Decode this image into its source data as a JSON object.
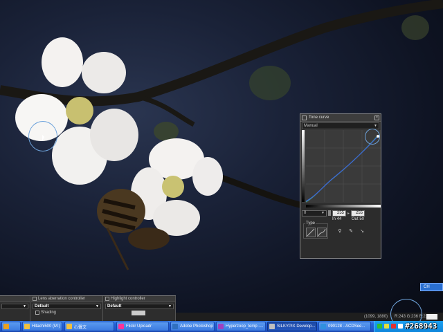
{
  "tone_curve": {
    "title": "Tone curve",
    "preset": "Manual",
    "channel": "0",
    "value_a": "255",
    "value_b": "255",
    "in_label": "In 44",
    "out_label": "Out 50",
    "type_label": "Type"
  },
  "panels": {
    "lens": {
      "title": "Lens aberration controller",
      "preset": "Default",
      "shading_label": "Shading"
    },
    "highlight": {
      "title": "Highlight controller",
      "preset": "Default"
    }
  },
  "status": {
    "coords": "(1099, 1880)",
    "rgb": "R:243 G:236 B:233"
  },
  "langbar": {
    "label": "CH"
  },
  "taskbar": {
    "items": [
      "Hitachi500 (M:)",
      "心聲文",
      "Flickr Uploadr",
      "Adobe Photoshop",
      "Hyperzoop_temp -...",
      "SILKYPIX Develop...",
      "090128 - ACDSee..."
    ]
  },
  "watermark": "#268943",
  "colors": {
    "accent": "#6fa4dc",
    "taskbar": "#2561d6",
    "panel": "#2c2c2c"
  }
}
